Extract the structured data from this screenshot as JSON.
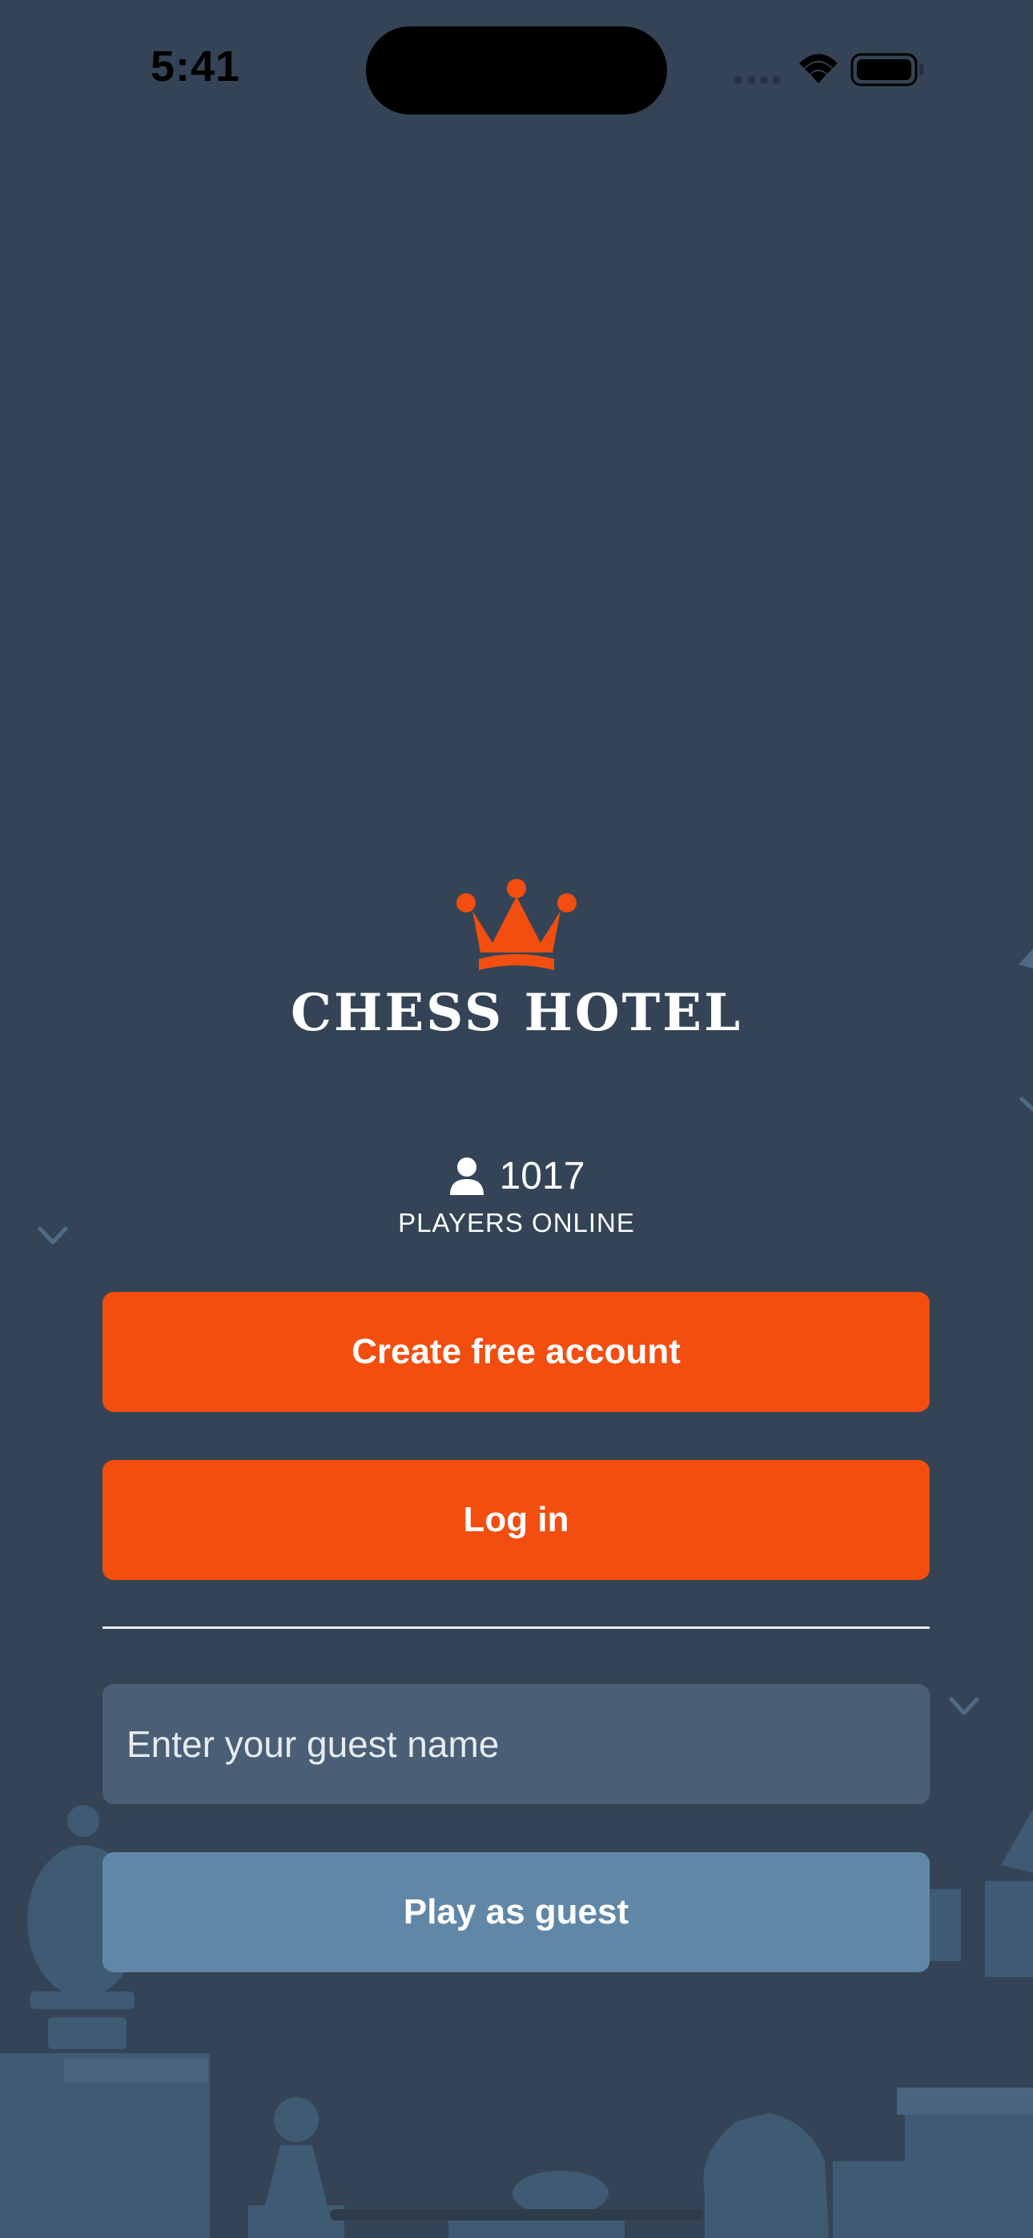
{
  "status_bar": {
    "time": "5:41"
  },
  "brand": {
    "name": "CHESS HOTEL"
  },
  "online": {
    "count": "1017",
    "label": "PLAYERS ONLINE"
  },
  "actions": {
    "create_account": "Create free account",
    "login": "Log in",
    "guest_placeholder": "Enter your guest name",
    "play_guest": "Play as guest"
  },
  "colors": {
    "background": "#344456",
    "accent": "#f24e0f",
    "input_bg": "#4a5e76",
    "guest_button": "#6187a7"
  },
  "icons": [
    "crown-icon",
    "person-icon",
    "wifi-icon",
    "battery-icon",
    "signal-icon",
    "chevron-down-icon"
  ]
}
